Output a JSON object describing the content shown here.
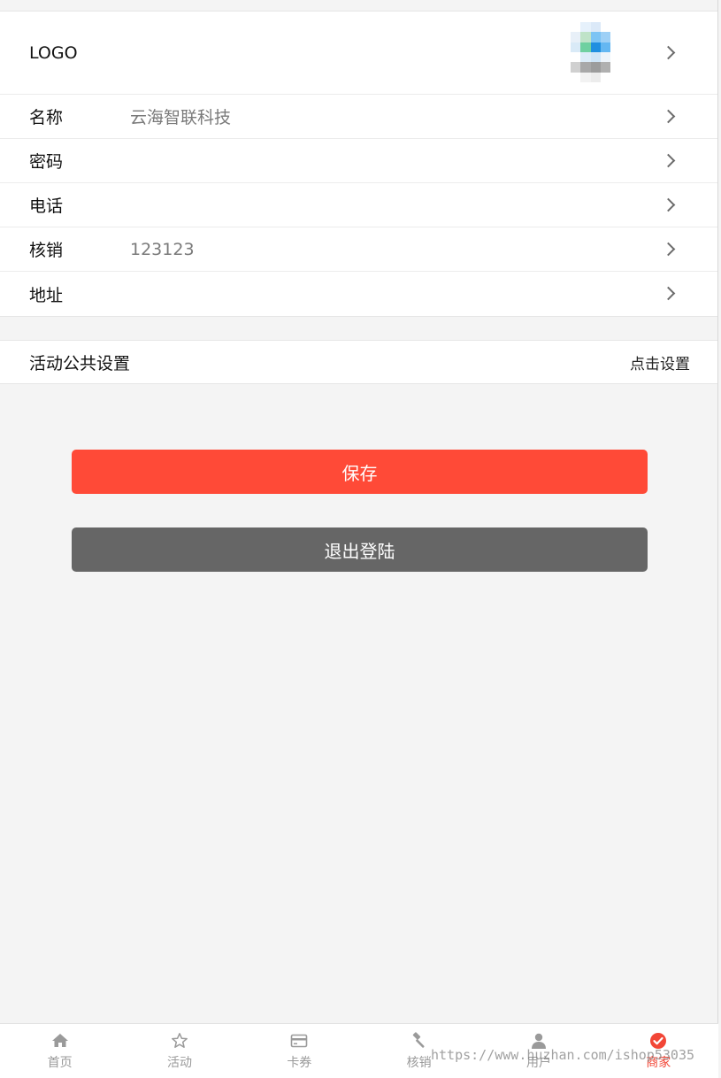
{
  "profile": {
    "logo_label": "LOGO",
    "fields": [
      {
        "label": "名称",
        "value": "云海智联科技"
      },
      {
        "label": "密码",
        "value": ""
      },
      {
        "label": "电话",
        "value": ""
      },
      {
        "label": "核销",
        "value": "123123"
      },
      {
        "label": "地址",
        "value": ""
      }
    ]
  },
  "activity": {
    "title": "活动公共设置",
    "action": "点击设置"
  },
  "buttons": {
    "save": "保存",
    "logout": "退出登陆"
  },
  "tabbar": {
    "items": [
      {
        "label": "首页",
        "icon": "home-icon"
      },
      {
        "label": "活动",
        "icon": "star-icon"
      },
      {
        "label": "卡券",
        "icon": "card-icon"
      },
      {
        "label": "核销",
        "icon": "hammer-icon"
      },
      {
        "label": "用户",
        "icon": "user-icon"
      },
      {
        "label": "商家",
        "icon": "check-circle-icon"
      }
    ],
    "active_index": 5
  },
  "colors": {
    "primary": "#ff4a37",
    "secondary": "#666666",
    "tab_active": "#f24636",
    "tab_inactive": "#9a9a9a"
  },
  "watermark": "https://www.huzhan.com/ishop53035"
}
